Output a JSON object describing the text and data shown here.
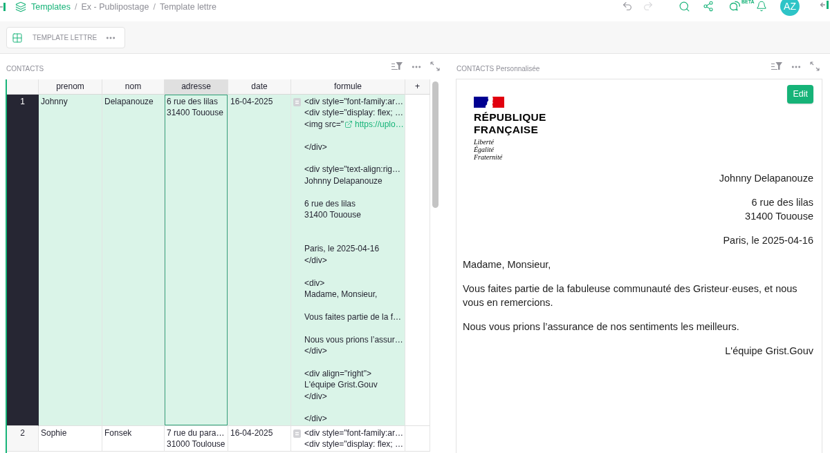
{
  "top_bar": {
    "breadcrumbs": [
      {
        "kind": "link",
        "label": "Templates"
      },
      {
        "kind": "separator",
        "label": "/"
      },
      {
        "kind": "text",
        "label": "Ex - Publipostage"
      },
      {
        "kind": "separator",
        "label": "/"
      },
      {
        "kind": "text",
        "label": "Template lettre"
      }
    ],
    "undo": {
      "disabled": false
    },
    "redo": {
      "disabled": true
    },
    "beta_label": "BETA",
    "avatar": "AZ"
  },
  "widget_tab": {
    "label": "TEMPLATE LETTRE"
  },
  "contacts_section": {
    "title": "CONTACTS",
    "table": {
      "columns": [
        {
          "label": "prenom",
          "selected": false
        },
        {
          "label": "nom",
          "selected": false
        },
        {
          "label": "adresse",
          "selected": true
        },
        {
          "label": "date",
          "selected": false
        },
        {
          "label": "formule",
          "selected": false
        }
      ],
      "add_column": "+",
      "rows": [
        {
          "number": "1",
          "selected": true,
          "cells": [
            {
              "kind": "text",
              "text": "Johnny"
            },
            {
              "kind": "text",
              "text": "Delapanouze"
            },
            {
              "kind": "text",
              "text": "6 rue des lilas\n31400 Tououse"
            },
            {
              "kind": "text",
              "text": "16-04-2025"
            },
            {
              "kind": "code",
              "text": "<div style=\"font-family:ar…\n<div style=\"display: flex; …",
              "link_prefix": "<img src=\"",
              "link": "https://uplo…",
              "rest": "\n</div>\n\n<div style=\"text-align:rig…\nJohnny Delapanouze\n\n6 rue des lilas\n31400 Tououse\n\n\nParis, le 2025-04-16\n</div>\n\n<div>\nMadame, Monsieur,\n\nVous faites partie de la f…\n\nNous vous prions l’assur…\n</div>\n\n<div align=\"right\">\nL'équipe Grist.Gouv\n</div>\n\n</div>"
            }
          ]
        },
        {
          "number": "2",
          "selected": false,
          "cells": [
            {
              "kind": "text",
              "text": "Sophie"
            },
            {
              "kind": "text",
              "text": "Fonsek"
            },
            {
              "kind": "text",
              "text": "7 rue du para…\n31000 Toulouse"
            },
            {
              "kind": "text",
              "text": "16-04-2025"
            },
            {
              "kind": "code",
              "text": "<div style=\"font-family:ar…\n<div style=\"display: flex; …"
            }
          ]
        }
      ]
    }
  },
  "custom_section": {
    "title": "CONTACTS Personnalisée",
    "edit_button": "Edit",
    "logo": {
      "name": "RÉPUBLIQUE\nFRANÇAISE",
      "motto": "Liberté\nÉgalité\nFraternité"
    },
    "letter": {
      "recipient_name": "Johnny Delapanouze",
      "recipient_address": "6 rue des lilas\n31400 Tououse",
      "place_date": "Paris, le 2025-04-16",
      "salutation": "Madame, Monsieur,",
      "paragraphs": [
        "Vous faites partie de la fabuleuse communauté des Gristeur·euses, et nous vous en remercions.",
        "Nous vous prions l’assurance de nos sentiments les meilleurs."
      ],
      "signature": "L'équipe Grist.Gouv"
    }
  }
}
